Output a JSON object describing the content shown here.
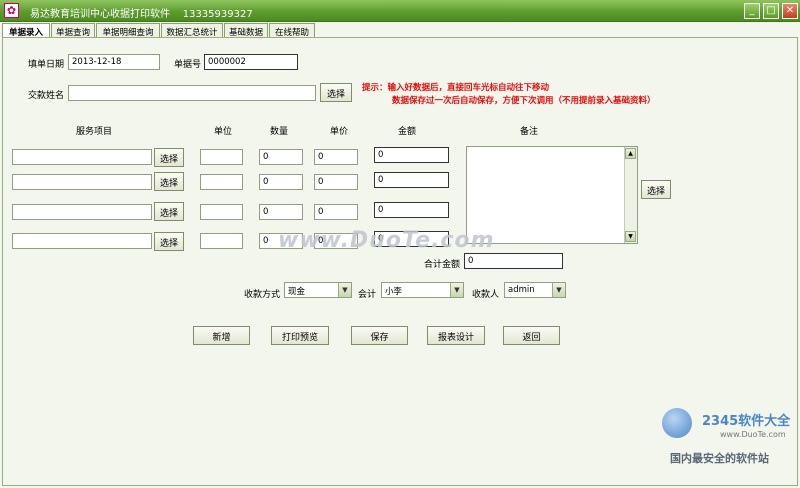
{
  "window": {
    "title": "易达教育培训中心收据打印软件    13335939327",
    "app_icon": "pink-app-icon",
    "minimize_glyph": "_",
    "maximize_glyph": "□",
    "close_glyph": "✕"
  },
  "tabs": [
    "单据录入",
    "单据查询",
    "单据明细查询",
    "数据汇总统计",
    "基础数据",
    "在线帮助"
  ],
  "form": {
    "date_label": "填单日期",
    "date_value": "2013-12-18",
    "receipt_no_label": "单据号",
    "receipt_no_value": "0000002",
    "payer_label": "交款姓名",
    "payer_value": "",
    "select_label": "选择",
    "hint_line1": "提示：输入好数据后，直接回车光标自动往下移动",
    "hint_line2": "数据保存过一次后自动保存，方便下次调用（不用提前录入基础资料）"
  },
  "items_table": {
    "headers": {
      "service": "服务项目",
      "unit": "单位",
      "quantity": "数量",
      "price": "单价",
      "amount": "金额",
      "note": "备注"
    },
    "rows": [
      {
        "service": "",
        "unit": "",
        "quantity": "0",
        "price": "0",
        "amount": "0"
      },
      {
        "service": "",
        "unit": "",
        "quantity": "0",
        "price": "0",
        "amount": "0"
      },
      {
        "service": "",
        "unit": "",
        "quantity": "0",
        "price": "0",
        "amount": "0"
      },
      {
        "service": "",
        "unit": "",
        "quantity": "0",
        "price": "0",
        "amount": "0"
      }
    ],
    "note_value": ""
  },
  "totals": {
    "total_label": "合计金额",
    "total_value": "0"
  },
  "payment": {
    "method_label": "收款方式",
    "method_value": "现金",
    "accountant_label": "会计",
    "accountant_value": "小李",
    "payee_label": "收款人",
    "payee_value": "admin"
  },
  "actions": {
    "new": "新增",
    "print_preview": "打印预览",
    "save": "保存",
    "report_design": "报表设计",
    "back": "返回"
  },
  "watermark": {
    "site": "www.DuoTe.com",
    "logo_main": "2345软件大全",
    "logo_sub": "www.DuoTe.com",
    "logo_slogan": "国内最安全的软件站"
  }
}
